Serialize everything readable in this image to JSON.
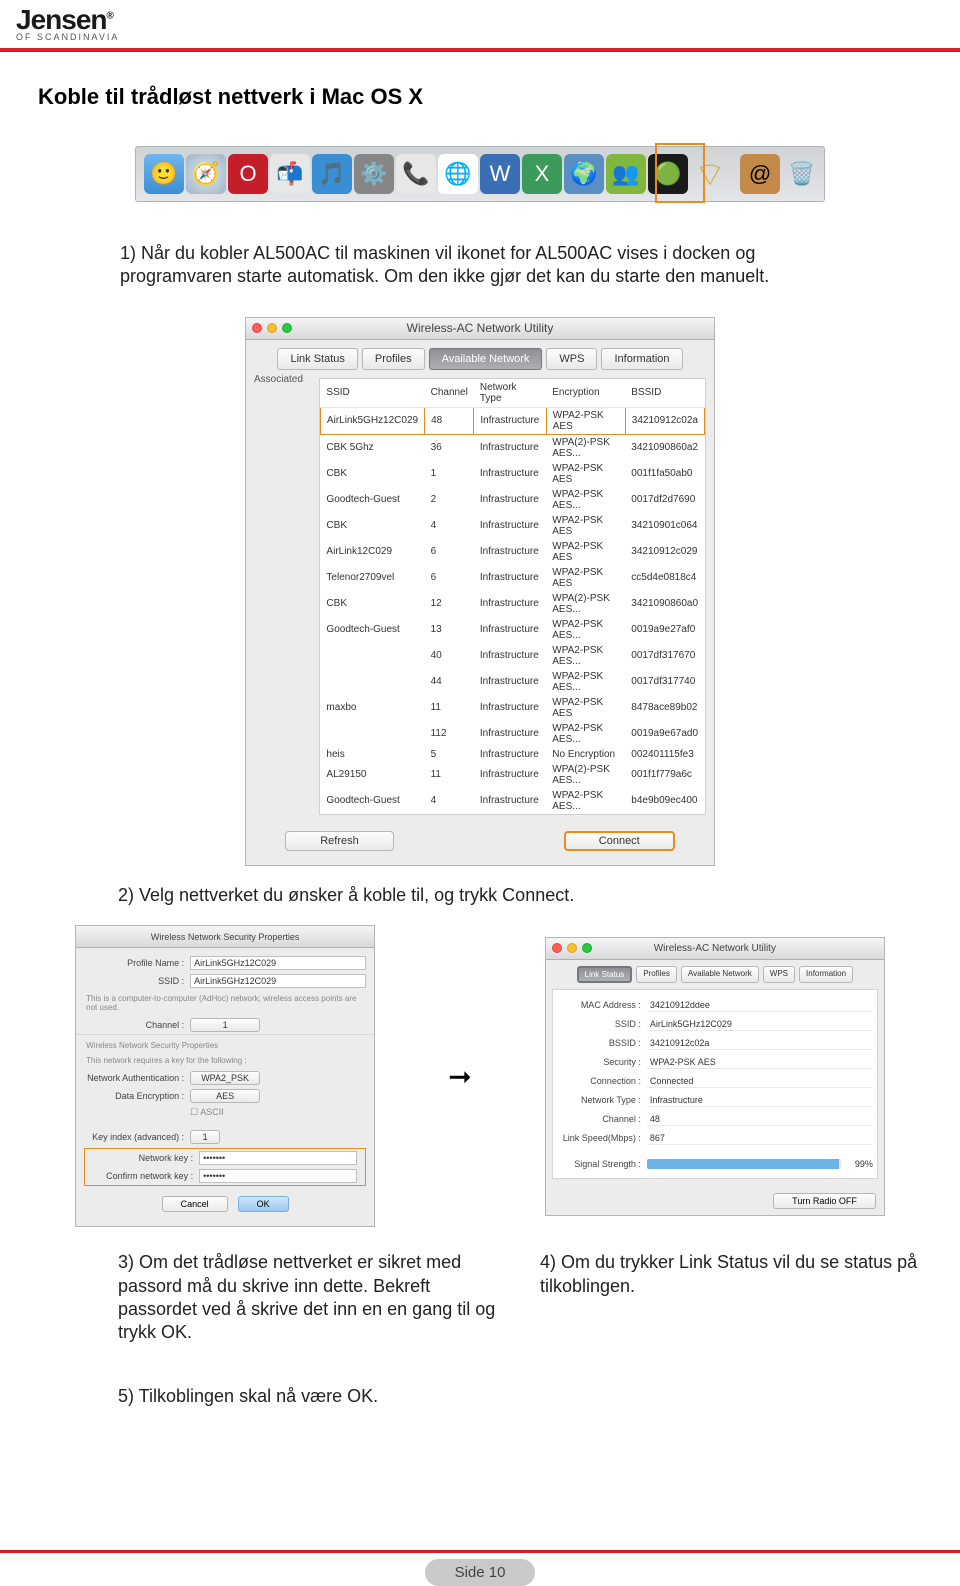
{
  "header": {
    "brand": "Jensen",
    "brand_sub": "OF SCANDINAVIA",
    "reg": "®"
  },
  "title": "Koble til trådløst nettverk i Mac OS X",
  "step1": "1) Når du kobler AL500AC til maskinen vil ikonet for AL500AC vises i docken og programvaren starte automatisk. Om den ikke gjør det kan du starte den manuelt.",
  "window1": {
    "title": "Wireless-AC Network Utility",
    "tabs": [
      "Link Status",
      "Profiles",
      "Available Network",
      "WPS",
      "Information"
    ],
    "assoc_label": "Associated",
    "headers": [
      "SSID",
      "Channel",
      "Network Type",
      "Encryption",
      "BSSID"
    ],
    "rows": [
      [
        "AirLink5GHz12C029",
        "48",
        "Infrastructure",
        "WPA2-PSK AES",
        "34210912c02a"
      ],
      [
        "CBK 5Ghz",
        "36",
        "Infrastructure",
        "WPA(2)-PSK AES...",
        "3421090860a2"
      ],
      [
        "CBK",
        "1",
        "Infrastructure",
        "WPA2-PSK AES",
        "001f1fa50ab0"
      ],
      [
        "Goodtech-Guest",
        "2",
        "Infrastructure",
        "WPA2-PSK AES...",
        "0017df2d7690"
      ],
      [
        "CBK",
        "4",
        "Infrastructure",
        "WPA2-PSK AES",
        "34210901c064"
      ],
      [
        "AirLink12C029",
        "6",
        "Infrastructure",
        "WPA2-PSK AES",
        "34210912c029"
      ],
      [
        "Telenor2709vel",
        "6",
        "Infrastructure",
        "WPA2-PSK AES",
        "cc5d4e0818c4"
      ],
      [
        "CBK",
        "12",
        "Infrastructure",
        "WPA(2)-PSK AES...",
        "3421090860a0"
      ],
      [
        "Goodtech-Guest",
        "13",
        "Infrastructure",
        "WPA2-PSK AES...",
        "0019a9e27af0"
      ],
      [
        "",
        "40",
        "Infrastructure",
        "WPA2-PSK AES...",
        "0017df317670"
      ],
      [
        "",
        "44",
        "Infrastructure",
        "WPA2-PSK AES...",
        "0017df317740"
      ],
      [
        "maxbo",
        "11",
        "Infrastructure",
        "WPA2-PSK AES",
        "8478ace89b02"
      ],
      [
        "",
        "112",
        "Infrastructure",
        "WPA2-PSK AES...",
        "0019a9e67ad0"
      ],
      [
        "heis",
        "5",
        "Infrastructure",
        "No Encryption",
        "002401115fe3"
      ],
      [
        "AL29150",
        "11",
        "Infrastructure",
        "WPA(2)-PSK AES...",
        "001f1f779a6c"
      ],
      [
        "Goodtech-Guest",
        "4",
        "Infrastructure",
        "WPA2-PSK AES...",
        "b4e9b09ec400"
      ]
    ],
    "refresh": "Refresh",
    "connect": "Connect"
  },
  "step2": "2) Velg nettverket du ønsker å koble til, og trykk Connect.",
  "security_dialog": {
    "title": "Wireless Network Security Properties",
    "profile_name_lbl": "Profile Name :",
    "profile_name": "AirLink5GHz12C029",
    "ssid_lbl": "SSID :",
    "ssid": "AirLink5GHz12C029",
    "adhoc_note": "This is a computer-to-computer (AdHoc) network; wireless access points are not used.",
    "channel_lbl": "Channel :",
    "channel": "1",
    "sec_heading": "Wireless Network Security Properties",
    "req_note": "This network requires a key for the following :",
    "auth_lbl": "Network Authentication :",
    "auth": "WPA2_PSK",
    "enc_lbl": "Data Encryption :",
    "enc": "AES",
    "ascii": "ASCII",
    "keyidx_lbl": "Key index (advanced) :",
    "keyidx": "1",
    "netkey_lbl": "Network key :",
    "netkey": "•••••••",
    "confirm_lbl": "Confirm network key :",
    "confirm": "•••••••",
    "cancel": "Cancel",
    "ok": "OK"
  },
  "link_status": {
    "title": "Wireless-AC Network Utility",
    "tabs": [
      "Link Status",
      "Profiles",
      "Available Network",
      "WPS",
      "Information"
    ],
    "rows": {
      "mac_lbl": "MAC Address :",
      "mac": "34210912ddee",
      "ssid_lbl": "SSID :",
      "ssid": "AirLink5GHz12C029",
      "bssid_lbl": "BSSID :",
      "bssid": "34210912c02a",
      "sec_lbl": "Security :",
      "sec": "WPA2-PSK AES",
      "conn_lbl": "Connection :",
      "conn": "Connected",
      "nettype_lbl": "Network Type :",
      "nettype": "Infrastructure",
      "chan_lbl": "Channel :",
      "chan": "48",
      "speed_lbl": "Link Speed(Mbps) :",
      "speed": "867",
      "signal_lbl": "Signal Strength :",
      "signal_pct": "99%"
    },
    "turnoff": "Turn Radio OFF"
  },
  "step3": "3) Om det trådløse nettverket er sikret med passord må du skrive inn dette. Bekreft passordet ved å skrive det inn en en gang til og trykk OK.",
  "step4": "4) Om du trykker Link Status vil du se status på tilkoblingen.",
  "step5": "5) Tilkoblingen skal nå være OK.",
  "footer": {
    "page": "Side 10"
  },
  "dock_icons": [
    "finder",
    "safari",
    "opera",
    "mail",
    "itunes",
    "settings",
    "skype",
    "chrome",
    "word",
    "excel",
    "globe",
    "people",
    "spotify",
    "wifi",
    "gap",
    "contacts",
    "trash"
  ]
}
